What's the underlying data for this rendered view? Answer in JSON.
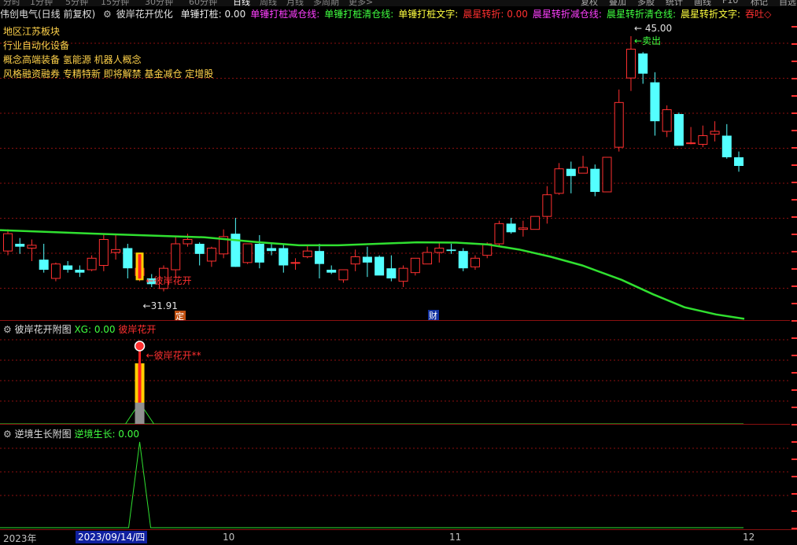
{
  "top_menu": [
    "分时",
    "1分钟",
    "5分钟",
    "15分钟",
    "30分钟",
    "60分钟",
    "日线",
    "周线",
    "月线",
    "多周期",
    "更多>"
  ],
  "top_menu_right": [
    "复权",
    "叠加",
    "多股",
    "统计",
    "画线",
    "F10",
    "标记",
    "自选"
  ],
  "title_row": {
    "stock": "伟创电气(日线 前复权)",
    "indicator": "彼岸花开优化",
    "fields": [
      {
        "text": "单锤打桩: 0.00",
        "color": "#e8e8e8"
      },
      {
        "text": "单锤打桩减仓线:",
        "color": "#ff40ff"
      },
      {
        "text": "单锤打桩清仓线:",
        "color": "#40ff40"
      },
      {
        "text": "单锤打桩文字:",
        "color": "#ffff40"
      },
      {
        "text": "晨星转折: 0.00",
        "color": "#ff3030"
      },
      {
        "text": "晨星转折减仓线:",
        "color": "#ff40ff"
      },
      {
        "text": "晨星转折清仓线:",
        "color": "#40ff40"
      },
      {
        "text": "晨星转折文字:",
        "color": "#ffff40"
      },
      {
        "text": "吞吐◇",
        "color": "#ff3030"
      }
    ]
  },
  "info_lines": [
    "地区江苏板块",
    "行业自动化设备",
    "概念高端装备 氢能源 机器人概念",
    "风格融资融券 专精特新 即将解禁 基金减仓 定增股"
  ],
  "annotations": {
    "high_price": "45.00",
    "sell_label": "卖出",
    "low_price": "31.91",
    "signal_label": "彼岸花开",
    "ding_badge": "定",
    "cai_badge": "财"
  },
  "sub1": {
    "name": "彼岸花开附图",
    "xg_label": "XG: 0.00",
    "signal_field": "彼岸花开",
    "signal_text": "彼岸花开**"
  },
  "sub2": {
    "name": "逆境生长附图",
    "value_label": "逆境生长: 0.00"
  },
  "xaxis": {
    "year": "2023年",
    "date_box": "2023/09/14/四",
    "m10": "10",
    "m11": "11",
    "m12": "12"
  },
  "colors": {
    "up": "#ff3030",
    "down": "#54ffff",
    "ma": "#30e030",
    "grid": "#8b1010"
  },
  "candles": [
    [
      30.1,
      31.6,
      29.8,
      31.3
    ],
    [
      30.6,
      31.0,
      29.9,
      30.4
    ],
    [
      30.3,
      30.9,
      29.4,
      30.5
    ],
    [
      29.5,
      30.6,
      28.6,
      28.8
    ],
    [
      28.2,
      29.3,
      28.0,
      29.2
    ],
    [
      29.1,
      29.4,
      28.6,
      28.8
    ],
    [
      28.8,
      29.1,
      28.3,
      28.6
    ],
    [
      28.8,
      29.8,
      28.7,
      29.6
    ],
    [
      29.1,
      31.3,
      28.7,
      30.9
    ],
    [
      30.0,
      31.2,
      29.5,
      30.2
    ],
    [
      30.3,
      30.6,
      28.2,
      28.9
    ],
    [
      28.4,
      29.0,
      28.0,
      28.9
    ],
    [
      28.2,
      28.5,
      27.6,
      27.8
    ],
    [
      27.5,
      29.1,
      27.3,
      28.9
    ],
    [
      28.8,
      31.1,
      28.3,
      30.6
    ],
    [
      30.6,
      31.3,
      30.4,
      30.9
    ],
    [
      30.6,
      30.7,
      29.1,
      29.9
    ],
    [
      29.4,
      30.4,
      29.0,
      30.3
    ],
    [
      29.9,
      31.6,
      29.6,
      31.1
    ],
    [
      31.3,
      32.4,
      29.0,
      29.0
    ],
    [
      29.3,
      30.6,
      29.2,
      30.6
    ],
    [
      30.6,
      31.2,
      28.9,
      29.3
    ],
    [
      30.3,
      30.7,
      29.8,
      30.1
    ],
    [
      30.3,
      30.6,
      28.6,
      29.1
    ],
    [
      29.3,
      29.6,
      28.8,
      29.3
    ],
    [
      29.7,
      30.5,
      29.6,
      30.1
    ],
    [
      30.1,
      30.6,
      28.2,
      29.2
    ],
    [
      28.8,
      29.1,
      28.5,
      28.6
    ],
    [
      28.1,
      28.8,
      27.9,
      28.8
    ],
    [
      29.2,
      30.2,
      28.7,
      29.7
    ],
    [
      29.7,
      30.4,
      28.3,
      29.3
    ],
    [
      29.7,
      29.8,
      29.1,
      28.4
    ],
    [
      28.9,
      29.8,
      28.0,
      28.2
    ],
    [
      28.0,
      29.1,
      27.6,
      28.9
    ],
    [
      28.6,
      29.6,
      28.4,
      29.6
    ],
    [
      29.2,
      30.4,
      29.2,
      30.0
    ],
    [
      30.0,
      30.7,
      29.3,
      30.3
    ],
    [
      30.2,
      30.6,
      29.9,
      30.1
    ],
    [
      30.1,
      30.3,
      28.7,
      28.9
    ],
    [
      29.0,
      29.8,
      28.8,
      29.6
    ],
    [
      29.8,
      30.7,
      29.6,
      30.6
    ],
    [
      30.6,
      32.2,
      30.4,
      32.0
    ],
    [
      32.0,
      32.4,
      31.3,
      31.4
    ],
    [
      31.6,
      32.2,
      31.1,
      31.7
    ],
    [
      31.6,
      32.2,
      31.6,
      32.5
    ],
    [
      32.5,
      34.6,
      32.0,
      34.0
    ],
    [
      34.1,
      36.2,
      34.0,
      35.8
    ],
    [
      35.8,
      36.3,
      34.1,
      35.3
    ],
    [
      35.5,
      36.7,
      35.5,
      35.9
    ],
    [
      35.8,
      36.1,
      33.9,
      34.2
    ],
    [
      34.2,
      36.2,
      34.2,
      36.6
    ],
    [
      37.3,
      41.3,
      37.0,
      40.4
    ],
    [
      42.1,
      45.0,
      41.2,
      44.1
    ],
    [
      43.8,
      43.9,
      41.7,
      42.4
    ],
    [
      41.8,
      42.5,
      38.1,
      39.1
    ],
    [
      38.4,
      40.2,
      38.0,
      39.9
    ],
    [
      39.6,
      39.7,
      37.9,
      37.4
    ],
    [
      37.6,
      38.7,
      37.5,
      37.6
    ],
    [
      37.5,
      38.8,
      37.3,
      38.1
    ],
    [
      38.2,
      39.1,
      37.7,
      38.4
    ],
    [
      38.1,
      38.9,
      36.5,
      36.6
    ],
    [
      36.6,
      37.0,
      35.6,
      36.0
    ]
  ],
  "ma_curve": [
    [
      0,
      31.55
    ],
    [
      120,
      31.3
    ],
    [
      260,
      31.05
    ],
    [
      330,
      30.7
    ],
    [
      380,
      30.5
    ],
    [
      430,
      30.5
    ],
    [
      480,
      30.6
    ],
    [
      530,
      30.7
    ],
    [
      580,
      30.68
    ],
    [
      620,
      30.55
    ],
    [
      660,
      30.2
    ],
    [
      700,
      29.7
    ],
    [
      740,
      29.1
    ],
    [
      790,
      28.1
    ],
    [
      830,
      27.1
    ],
    [
      870,
      26.2
    ],
    [
      910,
      25.7
    ],
    [
      946,
      25.4
    ]
  ],
  "spikes": {
    "sub1_index": 11,
    "sub2_index": 11
  }
}
